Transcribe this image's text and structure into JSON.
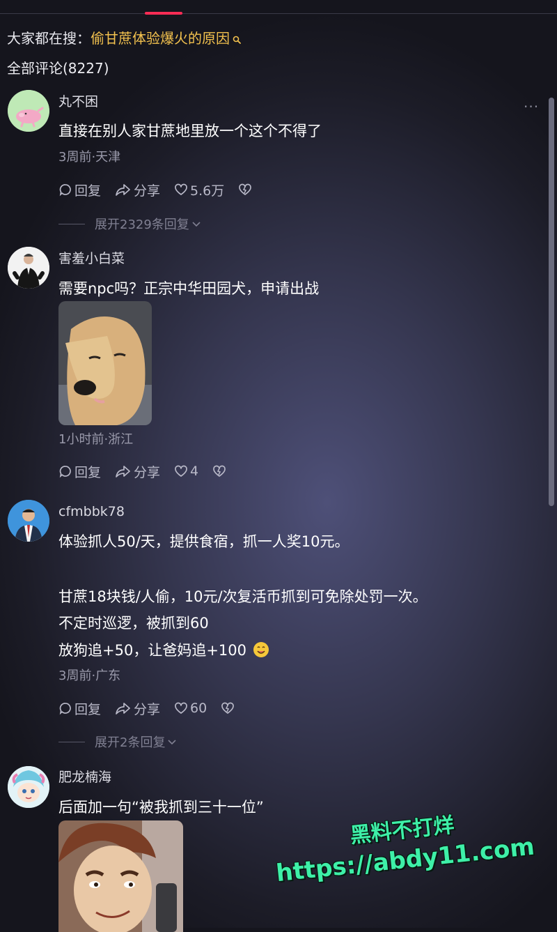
{
  "search": {
    "prefix": "大家都在搜：",
    "keyword": "偷甘蔗体验爆火的原因"
  },
  "comments_count_label": "全部评论(8227)",
  "comments": [
    {
      "username": "丸不困",
      "text_lines": [
        "直接在别人家甘蔗地里放一个这个不得了"
      ],
      "meta": "3周前·天津",
      "reply_label": "回复",
      "share_label": "分享",
      "likes": "5.6万",
      "expand_label": "展开2329条回复"
    },
    {
      "username": "害羞小白菜",
      "text_lines": [
        "需要npc吗？正宗中华田园犬，申请出战"
      ],
      "meta": "1小时前·浙江",
      "reply_label": "回复",
      "share_label": "分享",
      "likes": "4"
    },
    {
      "username": "cfmbbk78",
      "text_lines": [
        "体验抓人50/天，提供食宿，抓一人奖10元。",
        "甘蔗18块钱/人偷，10元/次复活币抓到可免除处罚一次。",
        "不定时巡逻，被抓到60",
        "放狗追+50，让爸妈追+100"
      ],
      "meta": "3周前·广东",
      "reply_label": "回复",
      "share_label": "分享",
      "likes": "60",
      "expand_label": "展开2条回复"
    },
    {
      "username": "肥龙楠海",
      "text_lines": [
        "后面加一句“被我抓到三十一位”"
      ]
    }
  ],
  "watermark": {
    "line1": "黑料不打烊",
    "line2": "https://abdy11.com"
  },
  "colors": {
    "accent": "#fe2c55",
    "keyword": "#f2c14e",
    "watermark": "#3ef0a8"
  },
  "icons": [
    "search-icon",
    "more-icon",
    "reply-icon",
    "share-icon",
    "heart-icon",
    "dislike-icon",
    "chevron-down-icon",
    "smile-emoji"
  ]
}
